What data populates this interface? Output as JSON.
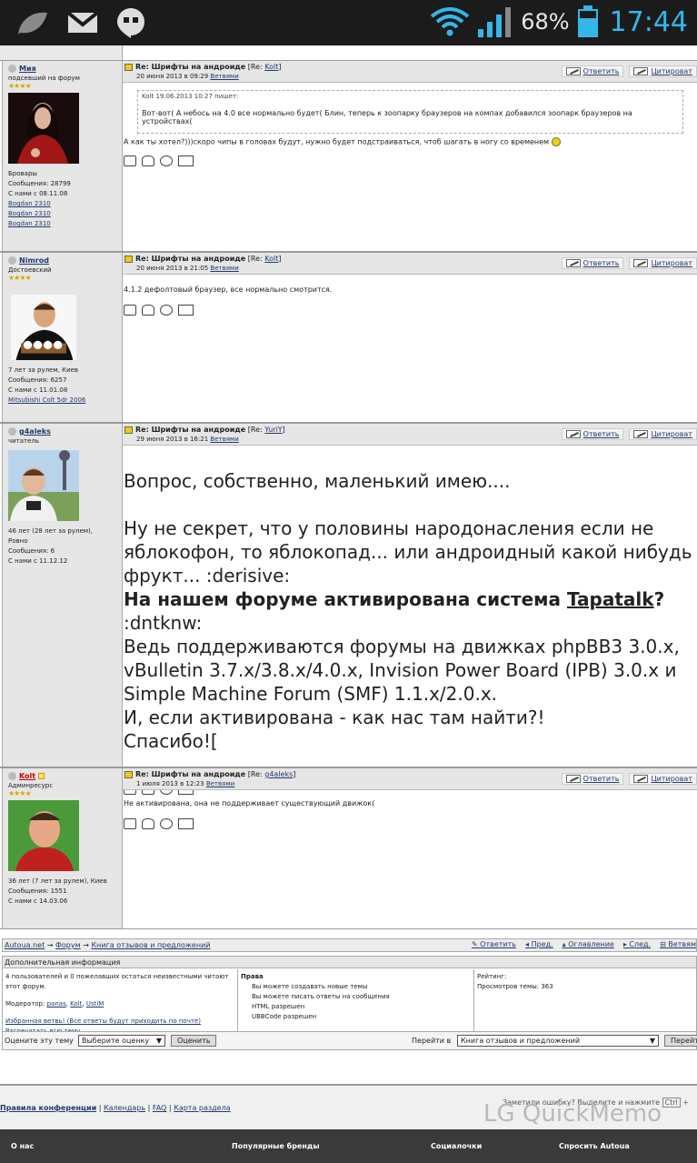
{
  "status": {
    "battery": "68%",
    "time": "17:44"
  },
  "posts": [
    {
      "username": "Мия",
      "rank": "подсевший на форум",
      "meta": [
        "Бровары",
        "Сообщения: 28799",
        "С нами с 08.11.08"
      ],
      "links": [
        "Bogdan 2310",
        "Bogdan 2310",
        "Bogdan 2310"
      ],
      "title_re": "Re: Шрифты на андроиде",
      "title_bracket_pre": "[Re: ",
      "title_bracket_user": "Kolt",
      "title_bracket_post": "]",
      "date": "20 июня 2013 в 09:29",
      "branches": "Ветвями",
      "quote_header": "Kolt 19.06.2013 10:27 пишет:",
      "quote_text": "Вот-вот( А небось на 4.0 все нормально будет( Блин, теперь к зоопарку браузеров на компах добавился зоопарк браузеров на устройствах(",
      "text": "А как ты хотел?)))скоро чипы в головах будут, нужно будет подстраиваться, чтоб шагать в ногу со временем"
    },
    {
      "username": "Nimrod",
      "rank": "Достоевский",
      "meta": [
        "7 лет за рулем, Киев",
        "Сообщения: 6257",
        "С нами с 11.01.08"
      ],
      "links": [
        "Mitsubishi Colt 5dr 2006"
      ],
      "title_re": "Re: Шрифты на андроиде",
      "title_bracket_pre": "[Re: ",
      "title_bracket_user": "Kolt",
      "title_bracket_post": "]",
      "date": "20 июня 2013 в 21:05",
      "branches": "Ветвями",
      "text": "4.1.2 дефолтовый браузер, все нормально смотрится."
    },
    {
      "username": "g4aleks",
      "rank": "читатель",
      "meta": [
        "46 лет (28 лет за рулем),",
        "Ровно",
        "Сообщения: 6",
        "С нами с 11.12.12"
      ],
      "title_re": "Re: Шрифты на андроиде",
      "title_bracket_pre": "[Re: ",
      "title_bracket_user": "YuriY",
      "title_bracket_post": "]",
      "date": "29 июня 2013 в 16:21",
      "branches": "Ветвями",
      "big_lines": {
        "l1": "Вопрос, собственно, маленький имею....",
        "l2": "Ну не секрет, что у половины народонасления если не яблокофон, то яблокопад... или андроидный какой нибудь фрукт... :derisive:",
        "l3_bold": "На нашем форуме активирована система",
        "l3_link": "Tapatalk",
        "l3_q": "?",
        "l3_rest": " :dntknw:",
        "l4": "Ведь поддерживаются форумы на движках phpBB3 3.0.x, vBulletin 3.7.x/3.8.x/4.0.x, Invision Power Board (IPB) 3.0.x и Simple Machine Forum (SMF) 1.1.x/2.0.x.",
        "l5": "И, если активирована - как нас там найти?!",
        "l6": "Спасибо![",
        "space": " "
      }
    },
    {
      "username": "Kolt",
      "rank": "Админресурс",
      "meta": [
        "36 лет (7 лет за рулем), Киев",
        "Сообщения: 1551",
        "С нами с 14.03.06"
      ],
      "title_re": "Re: Шрифты на андроиде",
      "title_bracket_pre": "[Re: ",
      "title_bracket_user": "g4aleks",
      "title_bracket_post": "]",
      "date": "1 июля 2013 в 12:23",
      "branches": "Ветвями",
      "text": "Не активирована, она не поддерживает существующий движок("
    }
  ],
  "actions": {
    "reply": "Ответить",
    "quote": "Цитироват"
  },
  "nav": {
    "crumb1": "Autoua.net",
    "arrow": "→",
    "crumb2": "Форум",
    "crumb3": "Книга отзывов и предложений",
    "reply": "Ответить",
    "prev": "Пред.",
    "toc": "Оглавление",
    "next": "След.",
    "branches": "Ветвям"
  },
  "additional": {
    "title": "Дополнительная информация",
    "users_online": "4 пользователей и 0 пожелавших остаться неизвестными читают этот форум.",
    "moderator_label": "Модератор:",
    "moderators": [
      "panas",
      "Kolt",
      "UstiM"
    ],
    "fav": "Избранная ветвь! (Все ответы будут приходить по почте)",
    "print": "Распечатать всю тему",
    "rights_title": "Права",
    "rights": [
      "Вы можете создавать новые темы",
      "Вы можете писать ответы на сообщения",
      "HTML разрешен",
      "UBBCode разрешен"
    ],
    "rating": "Рейтинг:",
    "views": "Просмотров темы: 363",
    "rate_label": "Оцените эту тему",
    "rate_select": "Выберите оценку",
    "rate_btn": "Оценить",
    "goto_label": "Перейти в",
    "goto_select": "Книга отзывов и предложений",
    "goto_btn": "Перейт"
  },
  "footer_links": {
    "rules": "Правила конференции",
    "calendar": "Календарь",
    "faq": "FAQ",
    "map": "Карта раздела",
    "sep": "|",
    "error_note": "Заметили ошибку? Выделите и нажмите",
    "ctrl": "Ctrl",
    "plus": "+"
  },
  "footer": {
    "about": "О нас",
    "brands": "Популярные бренды",
    "social": "Социалочки",
    "ask": "Спросить Autoua"
  },
  "watermark": "LG QuickMemo"
}
